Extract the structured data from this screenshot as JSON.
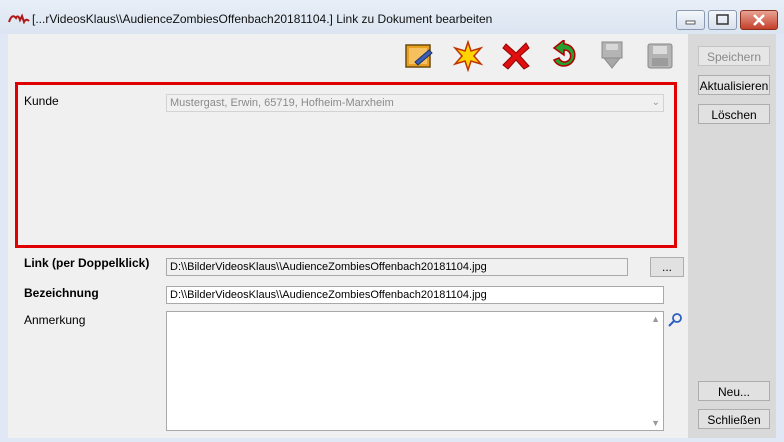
{
  "window": {
    "title": "[...rVideosKlaus\\\\AudienceZombiesOffenbach20181104.] Link zu Dokument bearbeiten"
  },
  "toolbar": {
    "icons": [
      "edit-document-icon",
      "new-star-icon",
      "delete-x-icon",
      "undo-icon",
      "save-download-icon",
      "save-disk-icon"
    ]
  },
  "side_buttons": {
    "speichern": "Speichern",
    "aktualisieren": "Aktualisieren",
    "loeschen": "Löschen",
    "neu": "Neu...",
    "schliessen": "Schließen"
  },
  "form": {
    "kunde_label": "Kunde",
    "kunde_value": "Mustergast, Erwin, 65719, Hofheim-Marxheim",
    "link_label": "Link (per Doppelklick)",
    "link_value": "D:\\\\BilderVideosKlaus\\\\AudienceZombiesOffenbach20181104.jpg",
    "browse_label": "...",
    "bezeichnung_label": "Bezeichnung",
    "bezeichnung_value": "D:\\\\BilderVideosKlaus\\\\AudienceZombiesOffenbach20181104.jpg",
    "anmerkung_label": "Anmerkung",
    "anmerkung_value": ""
  },
  "colors": {
    "highlight": "#e00000",
    "panel": "#d9d9d9"
  }
}
